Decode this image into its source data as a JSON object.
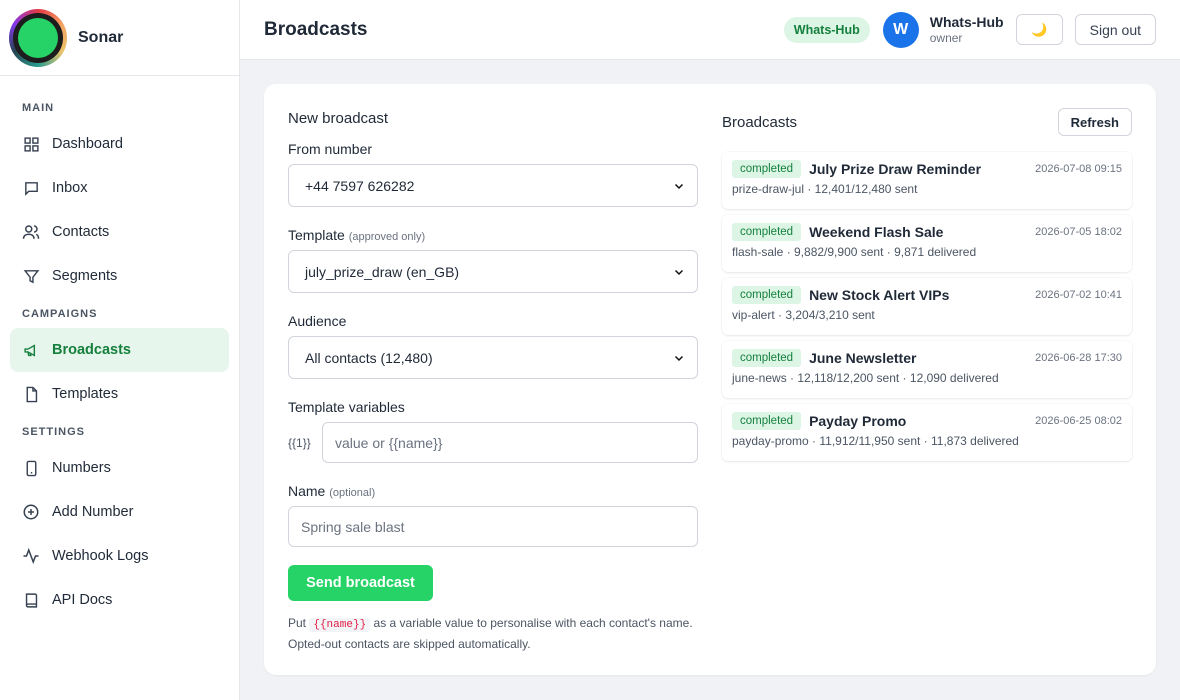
{
  "brand": {
    "name": "Sonar"
  },
  "sidebar": {
    "sections": [
      {
        "label": "MAIN"
      },
      {
        "label": "CAMPAIGNS"
      },
      {
        "label": "SETTINGS"
      }
    ],
    "items": [
      {
        "label": "Dashboard",
        "icon": "grid-icon"
      },
      {
        "label": "Inbox",
        "icon": "message-icon"
      },
      {
        "label": "Contacts",
        "icon": "users-icon"
      },
      {
        "label": "Segments",
        "icon": "filter-icon"
      },
      {
        "label": "Broadcasts",
        "icon": "megaphone-icon",
        "active": true
      },
      {
        "label": "Templates",
        "icon": "file-icon"
      },
      {
        "label": "Numbers",
        "icon": "phone-icon"
      },
      {
        "label": "Add Number",
        "icon": "plus-circle-icon"
      },
      {
        "label": "Webhook Logs",
        "icon": "activity-icon"
      },
      {
        "label": "API Docs",
        "icon": "book-icon"
      }
    ]
  },
  "header": {
    "title": "Broadcasts",
    "org_badge": "Whats-Hub",
    "avatar_initial": "W",
    "user_name": "Whats-Hub",
    "user_role": "owner",
    "theme_icon": "🌙",
    "sign_out": "Sign out"
  },
  "form": {
    "title": "New broadcast",
    "from_label": "From number",
    "from_value": "+44 7597 626282",
    "template_label": "Template",
    "template_note": "(approved only)",
    "template_value": "july_prize_draw (en_GB)",
    "audience_label": "Audience",
    "audience_value": "All contacts (12,480)",
    "variables_label": "Template variables",
    "var_tag": "{{1}}",
    "var_placeholder": "value or {{name}}",
    "name_label": "Name",
    "name_note": "(optional)",
    "name_placeholder": "Spring sale blast",
    "send_label": "Send broadcast",
    "help_prefix": "Put",
    "help_code": "{{name}}",
    "help_suffix": "as a variable value to personalise with each contact's name.",
    "help_line2": "Opted-out contacts are skipped automatically."
  },
  "list": {
    "title": "Broadcasts",
    "refresh_label": "Refresh",
    "items": [
      {
        "status": "completed",
        "name": "July Prize Draw Reminder",
        "date": "2026-07-08 09:15",
        "meta": "prize-draw-jul · 12,401/12,480 sent"
      },
      {
        "status": "completed",
        "name": "Weekend Flash Sale",
        "date": "2026-07-05 18:02",
        "meta": "flash-sale · 9,882/9,900 sent · 9,871 delivered"
      },
      {
        "status": "completed",
        "name": "New Stock Alert VIPs",
        "date": "2026-07-02 10:41",
        "meta": "vip-alert · 3,204/3,210 sent"
      },
      {
        "status": "completed",
        "name": "June Newsletter",
        "date": "2026-06-28 17:30",
        "meta": "june-news · 12,118/12,200 sent · 12,090 delivered"
      },
      {
        "status": "completed",
        "name": "Payday Promo",
        "date": "2026-06-25 08:02",
        "meta": "payday-promo · 11,912/11,950 sent · 11,873 delivered"
      }
    ]
  },
  "colors": {
    "accent": "#25d366",
    "accent_text": "#15803d",
    "accent_bg": "#dcf5e5",
    "avatar": "#1a73e8"
  }
}
